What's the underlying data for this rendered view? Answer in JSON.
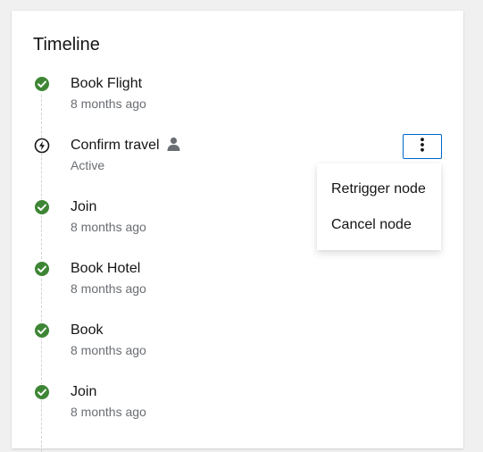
{
  "card": {
    "title": "Timeline"
  },
  "timeline": {
    "items": [
      {
        "name": "Book Flight",
        "time": "8 months ago",
        "status_icon": "check-circle-icon"
      },
      {
        "name": "Confirm travel",
        "time": "Active",
        "status_icon": "bolt-circle-icon",
        "user_icon": "user-icon"
      },
      {
        "name": "Join",
        "time": "8 months ago",
        "status_icon": "check-circle-icon"
      },
      {
        "name": "Book Hotel",
        "time": "8 months ago",
        "status_icon": "check-circle-icon"
      },
      {
        "name": "Book",
        "time": "8 months ago",
        "status_icon": "check-circle-icon"
      },
      {
        "name": "Join",
        "time": "8 months ago",
        "status_icon": "check-circle-icon"
      }
    ]
  },
  "menu": {
    "kebab_icon": "kebab-vertical-icon",
    "items": [
      {
        "label": "Retrigger node"
      },
      {
        "label": "Cancel node"
      }
    ]
  },
  "colors": {
    "success": "#3e8635",
    "accent": "#0066cc",
    "muted_text": "#6a6e73",
    "user_icon": "#6a6e73"
  }
}
